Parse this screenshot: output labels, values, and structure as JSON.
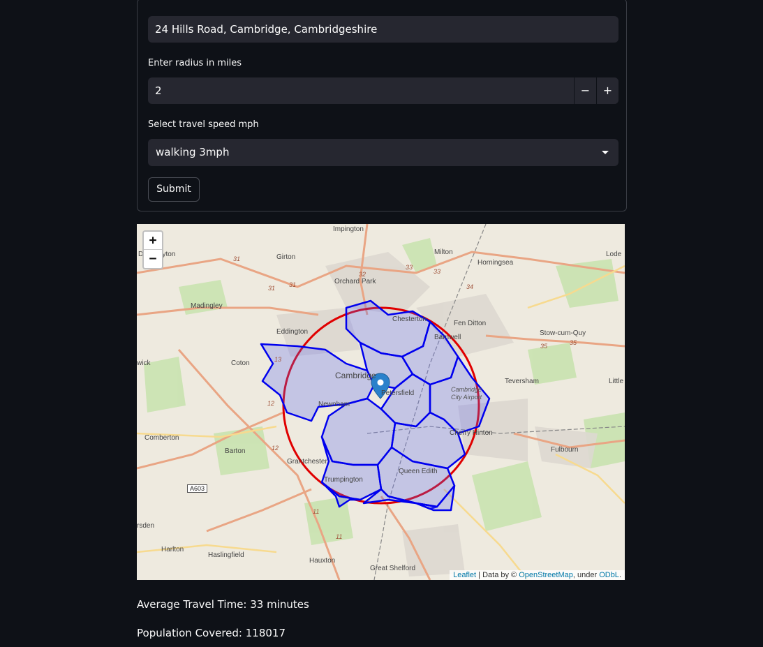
{
  "form": {
    "address_value": "24 Hills Road, Cambridge, Cambridgeshire",
    "radius_label": "Enter radius in miles",
    "radius_value": "2",
    "decrement_label": "−",
    "increment_label": "+",
    "speed_label": "Select travel speed mph",
    "speed_value": "walking 3mph",
    "submit_label": "Submit"
  },
  "map": {
    "zoom_in": "+",
    "zoom_out": "−",
    "attribution": {
      "leaflet": "Leaflet",
      "data_by": " | Data by © ",
      "osm": "OpenStreetMap",
      "under": ", under ",
      "odbl": "ODbL",
      "end": "."
    },
    "places": {
      "impington": "Impington",
      "milton": "Milton",
      "lode": "Lode",
      "dry_drayton": "Dry Drayton",
      "girton": "Girton",
      "horningsea": "Horningsea",
      "orchard_park": "Orchard Park",
      "madingley": "Madingley",
      "eddington": "Eddington",
      "fen_ditton": "Fen Ditton",
      "stow_cum_quy": "Stow-cum-Quy",
      "coton": "Coton",
      "hardwick": "wick",
      "cambridge": "Cambridge",
      "teversham": "Teversham",
      "little": "Little",
      "newnham": "Newnham",
      "cambridge_city_airport": "Cambridge City Airport",
      "comberton": "Comberton",
      "cherry_hinton": "Cherry Hinton",
      "barton": "Barton",
      "fulbourn": "Fulbourn",
      "grantchester": "Grantchester",
      "trumpington": "Trumpington",
      "harston_partial": "rsden",
      "harlton": "Harlton",
      "haslingfield": "Haslingfield",
      "hauxton": "Hauxton",
      "great_shelford": "Great Shelford",
      "barnwell": "Barnwell",
      "chesterton": "Chesterton",
      "petersfield": "Petersfield",
      "queen_edith": "Queen Edith"
    },
    "roads": [
      "31",
      "31",
      "31",
      "32",
      "33",
      "33",
      "34",
      "35",
      "35",
      "13",
      "12",
      "12",
      "11",
      "11"
    ],
    "road_shield": "A603"
  },
  "stats": {
    "avg_travel": "Average Travel Time: 33 minutes",
    "population": "Population Covered: 118017"
  }
}
